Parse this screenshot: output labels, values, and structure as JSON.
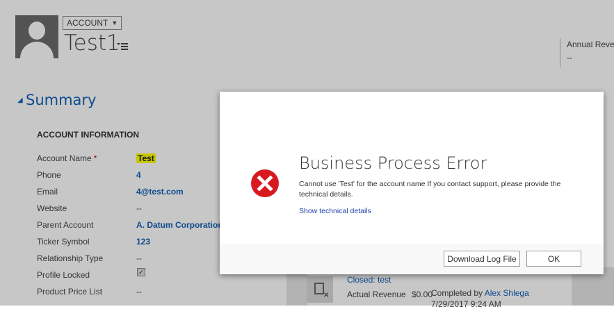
{
  "header": {
    "entity_type": "ACCOUNT",
    "record_name": "Test1",
    "header_field_label": "Annual Reve",
    "header_field_value": "--"
  },
  "summary": {
    "title": "Summary",
    "section_title": "ACCOUNT INFORMATION",
    "fields": [
      {
        "label": "Account Name",
        "value": "Test",
        "required": "*"
      },
      {
        "label": "Phone",
        "value": "4"
      },
      {
        "label": "Email",
        "value": "4@test.com"
      },
      {
        "label": "Website",
        "value": "--"
      },
      {
        "label": "Parent Account",
        "value": "A. Datum Corporation"
      },
      {
        "label": "Ticker Symbol",
        "value": "123"
      },
      {
        "label": "Relationship Type",
        "value": "--"
      },
      {
        "label": "Profile Locked",
        "value": "checked"
      },
      {
        "label": "Product Price List",
        "value": "--"
      }
    ]
  },
  "activity": {
    "title": "Closed: test",
    "revenue_label": "Actual Revenue",
    "revenue_value": "$0.00",
    "completed_label": "Completed by",
    "owner": "Alex Shlega",
    "date": "7/29/2017 9:24 AM"
  },
  "dialog": {
    "title": "Business Process Error",
    "message": "Cannot use 'Test' for the account name If you contact support, please provide the technical details.",
    "link": "Show technical details",
    "download_label": "Download Log File",
    "ok_label": "OK",
    "icon_color": "#d71920"
  }
}
